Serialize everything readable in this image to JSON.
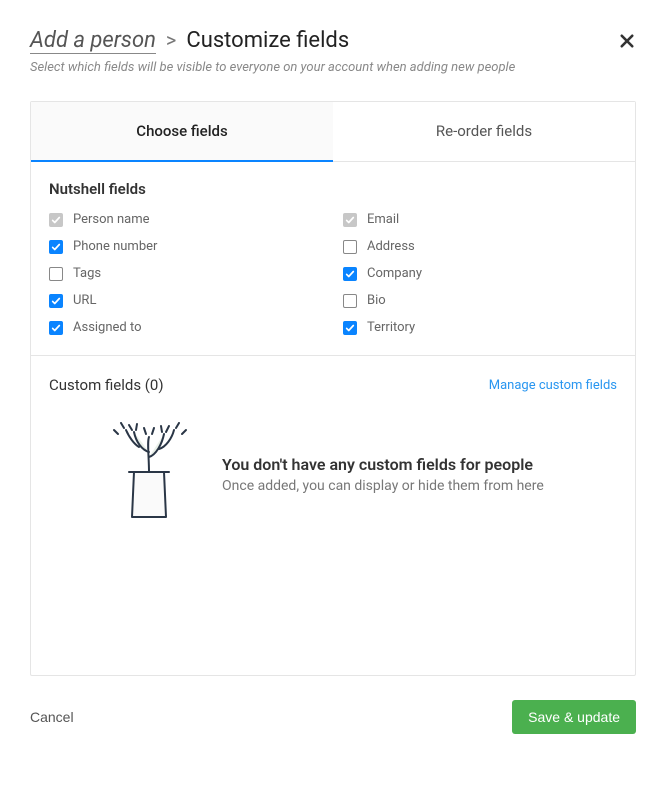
{
  "breadcrumb": {
    "parent": "Add a person",
    "separator": ">",
    "current": "Customize fields"
  },
  "subtitle": "Select which fields will be visible to everyone on your account when adding new people",
  "tabs": {
    "choose": "Choose fields",
    "reorder": "Re-order fields"
  },
  "nutshell": {
    "title": "Nutshell fields",
    "fields": {
      "person_name": {
        "label": "Person name",
        "checked": true,
        "locked": true
      },
      "email": {
        "label": "Email",
        "checked": true,
        "locked": true
      },
      "phone": {
        "label": "Phone number",
        "checked": true,
        "locked": false
      },
      "address": {
        "label": "Address",
        "checked": false,
        "locked": false
      },
      "tags": {
        "label": "Tags",
        "checked": false,
        "locked": false
      },
      "company": {
        "label": "Company",
        "checked": true,
        "locked": false
      },
      "url": {
        "label": "URL",
        "checked": true,
        "locked": false
      },
      "bio": {
        "label": "Bio",
        "checked": false,
        "locked": false
      },
      "assigned_to": {
        "label": "Assigned to",
        "checked": true,
        "locked": false
      },
      "territory": {
        "label": "Territory",
        "checked": true,
        "locked": false
      }
    }
  },
  "custom": {
    "title": "Custom fields (0)",
    "manage_link": "Manage custom fields",
    "empty_title": "You don't have any custom fields for people",
    "empty_sub": "Once added, you can display or hide them from here"
  },
  "footer": {
    "cancel": "Cancel",
    "save": "Save & update"
  }
}
